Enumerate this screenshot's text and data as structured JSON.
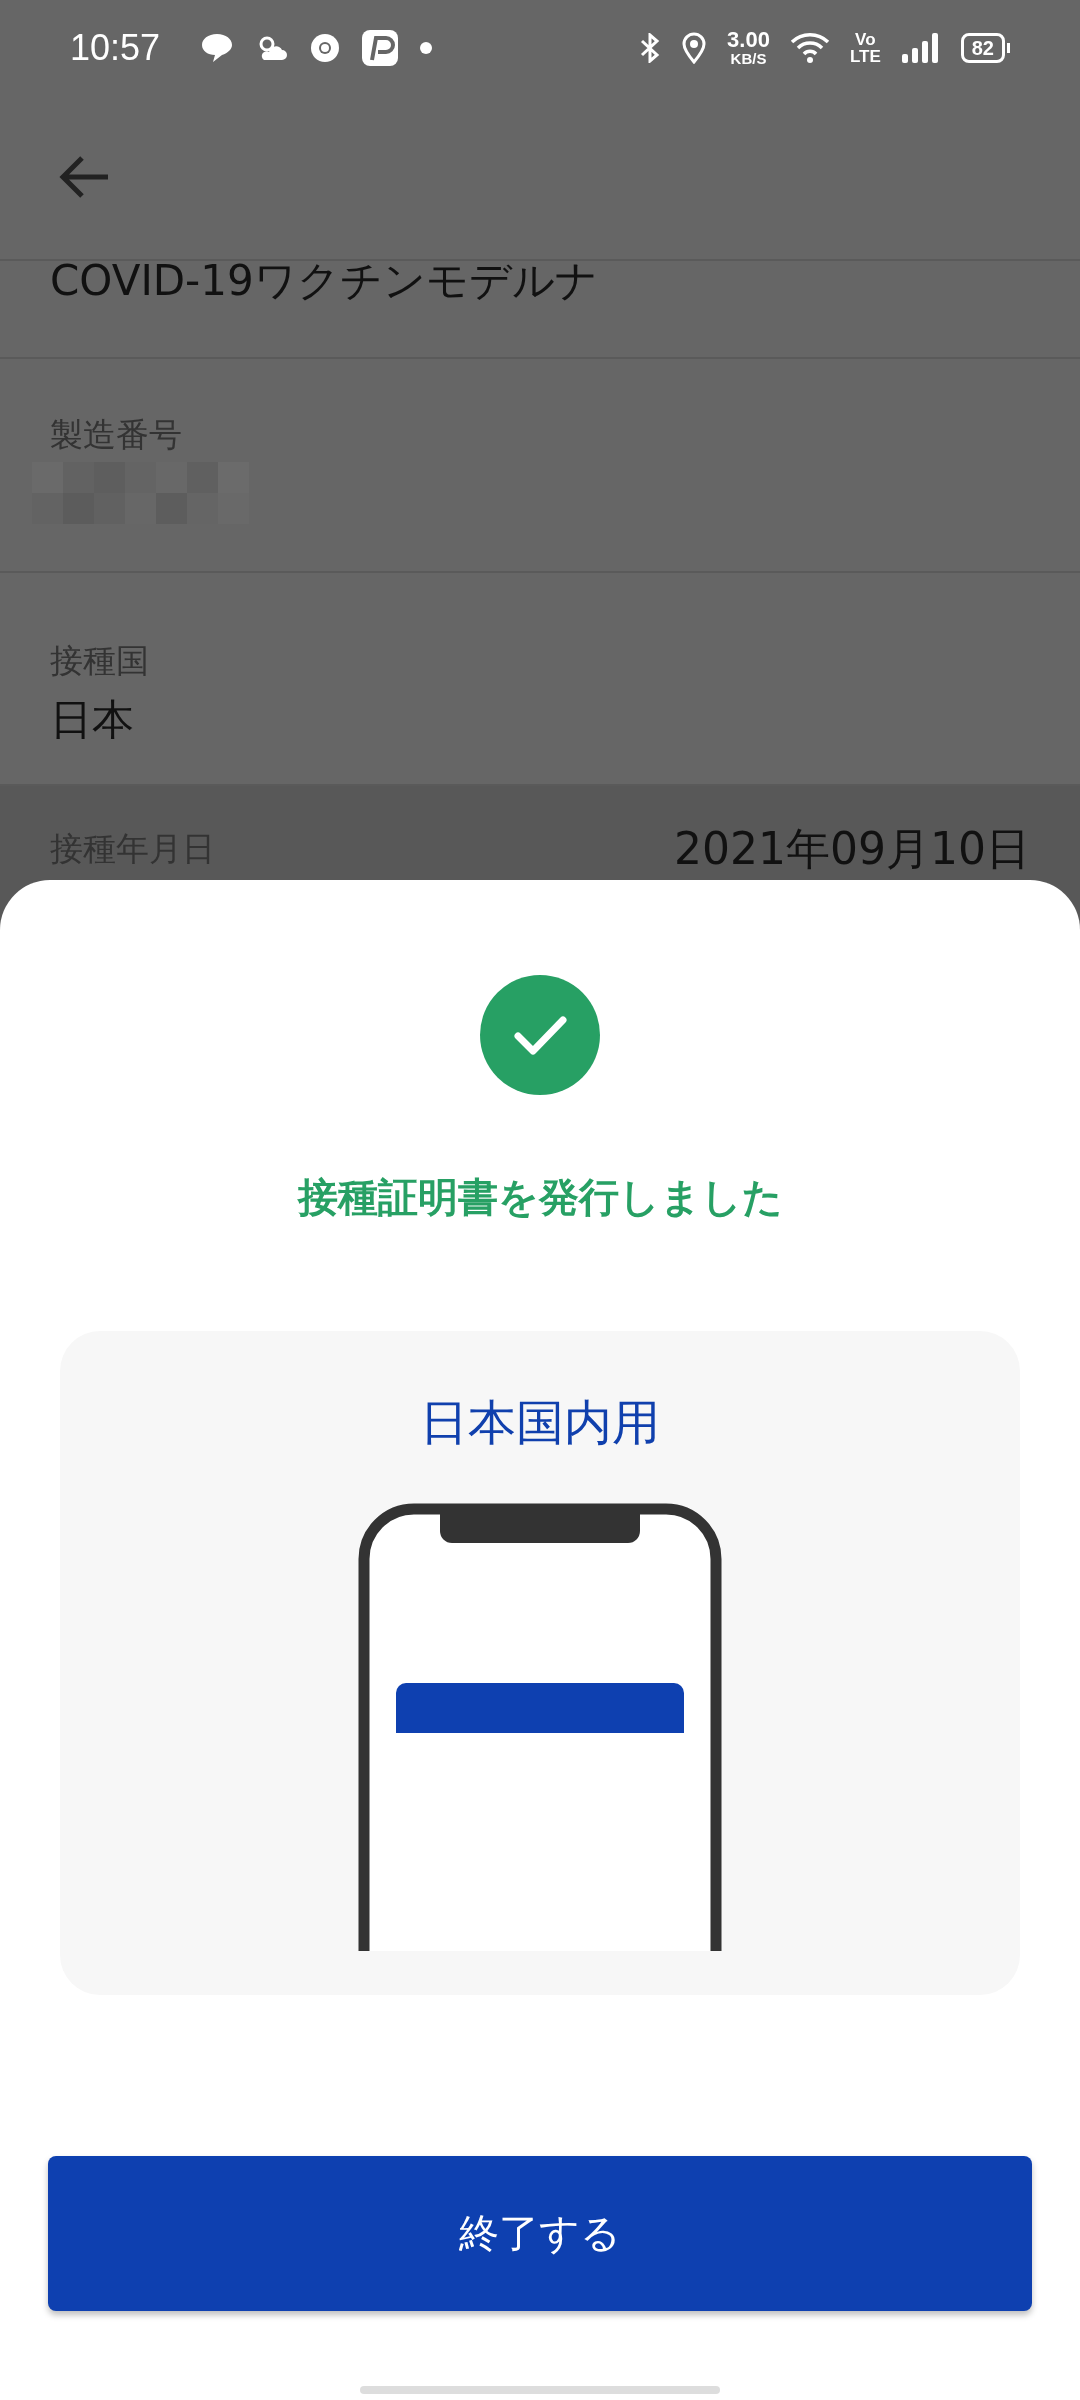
{
  "status_bar": {
    "time": "10:57",
    "net_speed": "3.00",
    "net_unit": "KB/S",
    "volte_top": "Vo",
    "volte_bottom": "LTE",
    "battery": "82"
  },
  "details": [
    {
      "kind": "value_only",
      "value": "COVID-19ワクチンモデルナ",
      "highlighted": false
    },
    {
      "kind": "redacted",
      "label": "製造番号",
      "highlighted": false
    },
    {
      "kind": "stacked",
      "label": "接種国",
      "value": "日本",
      "highlighted": false
    },
    {
      "kind": "inline",
      "label": "接種年月日",
      "value": "2021年09月10日",
      "highlighted": true
    }
  ],
  "dialog": {
    "title": "接種証明書を発行しました",
    "card_title": "日本国内用",
    "button": "終了する"
  }
}
